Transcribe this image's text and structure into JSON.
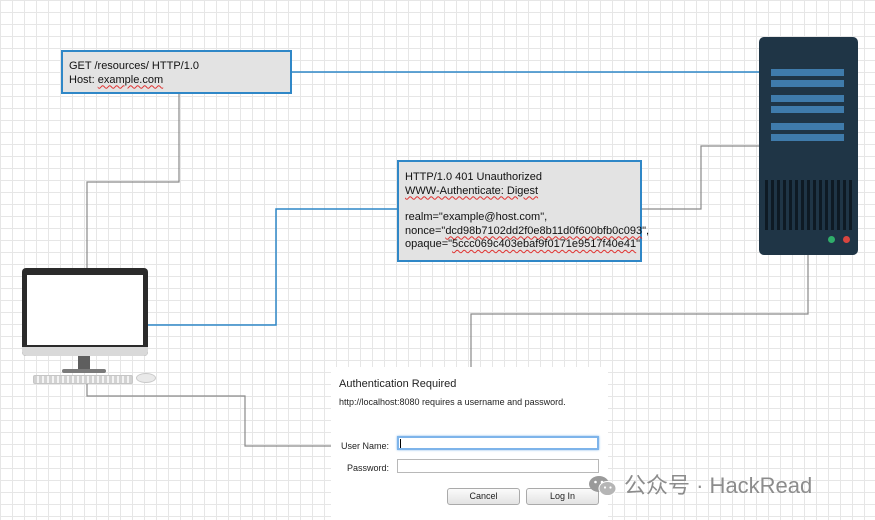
{
  "request": {
    "line1": "GET /resources/ HTTP/1.0",
    "line2_label": "Host: ",
    "line2_value": "example.com"
  },
  "response": {
    "status": "HTTP/1.0 401 Unauthorized",
    "header": "WWW-Authenticate: Digest",
    "realm": "realm=\"example@host.com\",",
    "nonce_label": "nonce=\"",
    "nonce_value": "dcd98b7102dd2f0e8b11d0f600bfb0c093",
    "nonce_end": "\",",
    "opaque_label": "opaque=\"",
    "opaque_value": "5ccc069c403ebaf9f0171e9517f40e41",
    "opaque_end": "\""
  },
  "dialog": {
    "title": "Authentication Required",
    "message": "http://localhost:8080 requires a username and password.",
    "username_label": "User Name:",
    "username_value": "",
    "password_label": "Password:",
    "password_value": "",
    "cancel_label": "Cancel",
    "login_label": "Log In"
  },
  "watermark": {
    "text": "公众号 · HackRead",
    "icon": "wechat-icon"
  },
  "colors": {
    "note_border": "#2f87c7",
    "note_fill": "#e3e3e3",
    "server_body": "#1f3546",
    "server_bar": "#3f7bab",
    "led_green": "#2fae6a",
    "led_red": "#d9453f",
    "connector_blue": "#2f87c7",
    "connector_gray": "#8a8a8a"
  }
}
